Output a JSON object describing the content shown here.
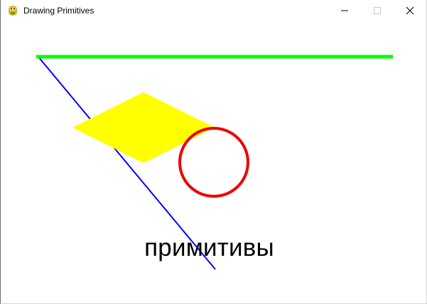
{
  "window": {
    "title": "Drawing Primitives",
    "icon": "python-snake-icon",
    "controls": {
      "minimize_icon": "minimize-icon",
      "maximize_icon": "maximize-icon",
      "close_icon": "close-icon"
    }
  },
  "canvas": {
    "background": "#ffffff",
    "caption": "примитивы",
    "caption_color": "#000000",
    "primitives": {
      "top_line_color": "#00ff00",
      "diagonal_line_color": "#0000ff",
      "rhombus_color": "#ffff00",
      "circle_color": "#ee0000"
    }
  }
}
